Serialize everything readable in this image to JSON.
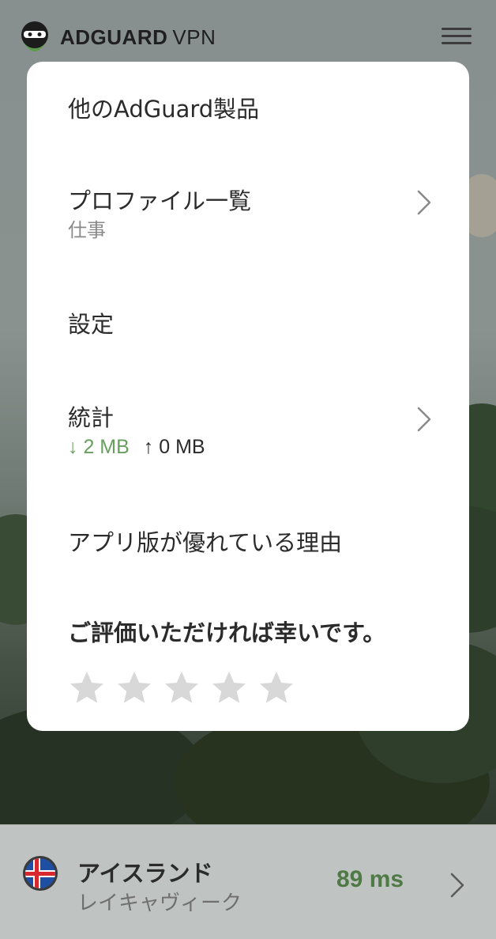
{
  "app": {
    "brand": "ADGUARD",
    "product": "VPN"
  },
  "menu": {
    "items": [
      {
        "label": "他のAdGuard製品"
      },
      {
        "label": "プロファイル一覧",
        "sub": "仕事"
      },
      {
        "label": "設定"
      },
      {
        "label": "統計",
        "download": "↓ 2 MB",
        "upload": "↑ 0 MB"
      },
      {
        "label": "アプリ版が優れている理由"
      }
    ],
    "rating": {
      "title": "ご評価いただければ幸いです。",
      "stars": 5
    }
  },
  "location": {
    "country": "アイスランド",
    "city": "レイキャヴィーク",
    "ping": "89 ms"
  },
  "colors": {
    "accent": "#68a05f",
    "ping": "#4f7a45",
    "star": "#d8d8d8"
  }
}
